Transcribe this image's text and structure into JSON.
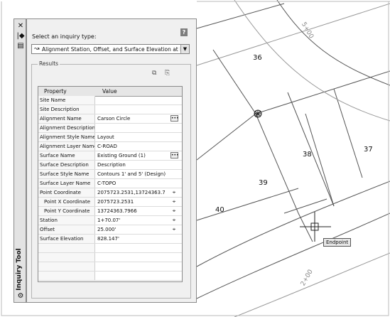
{
  "drawing": {
    "parcel_labels": [
      "36",
      "38",
      "37",
      "39",
      "40"
    ],
    "station_labels": [
      "5+00",
      "2+00"
    ],
    "endpoint_tooltip": "Endpoint"
  },
  "palette": {
    "title": "Inquiry Tool",
    "strip_icons": [
      "close-icon",
      "auto-hide-icon",
      "properties-icon",
      "inquiry-tool-icon"
    ],
    "help_label": "?",
    "select_label": "Select an inquiry type:",
    "inquiry_type": "Alignment Station, Offset, and Surface Elevation at P",
    "results_title": "Results",
    "columns": [
      "Property",
      "Value"
    ],
    "rows": [
      {
        "property": "Site Name",
        "value": "",
        "button": ""
      },
      {
        "property": "Site Description",
        "value": "",
        "button": ""
      },
      {
        "property": "Alignment Name",
        "value": "Carson Circle",
        "button": "ellipsis"
      },
      {
        "property": "Alignment Description",
        "value": "",
        "button": ""
      },
      {
        "property": "Alignment Style Name",
        "value": "Layout",
        "button": ""
      },
      {
        "property": "Alignment Layer Name",
        "value": "C-ROAD",
        "button": ""
      },
      {
        "property": "Surface Name",
        "value": "Existing Ground (1)",
        "button": "ellipsis"
      },
      {
        "property": "Surface Description",
        "value": "Description",
        "button": ""
      },
      {
        "property": "Surface Style Name",
        "value": "Contours 1' and 5' (Design)",
        "button": ""
      },
      {
        "property": "Surface Layer Name",
        "value": "C-TOPO",
        "button": ""
      },
      {
        "property": "Point Coordinate",
        "value": "2075723.2531,13724363.7",
        "button": "pick"
      },
      {
        "property": "Point X Coordinate",
        "value": "2075723.2531",
        "button": "pick",
        "indent": true
      },
      {
        "property": "Point Y Coordinate",
        "value": "13724363.7966",
        "button": "pick",
        "indent": true
      },
      {
        "property": "Station",
        "value": "1+70.07'",
        "button": "pick"
      },
      {
        "property": "Offset",
        "value": "25.000'",
        "button": "pick"
      },
      {
        "property": "Surface Elevation",
        "value": "828.147'",
        "button": ""
      },
      {
        "property": "",
        "value": "",
        "button": ""
      },
      {
        "property": "",
        "value": "",
        "button": ""
      },
      {
        "property": "",
        "value": "",
        "button": ""
      },
      {
        "property": "",
        "value": "",
        "button": ""
      }
    ]
  }
}
